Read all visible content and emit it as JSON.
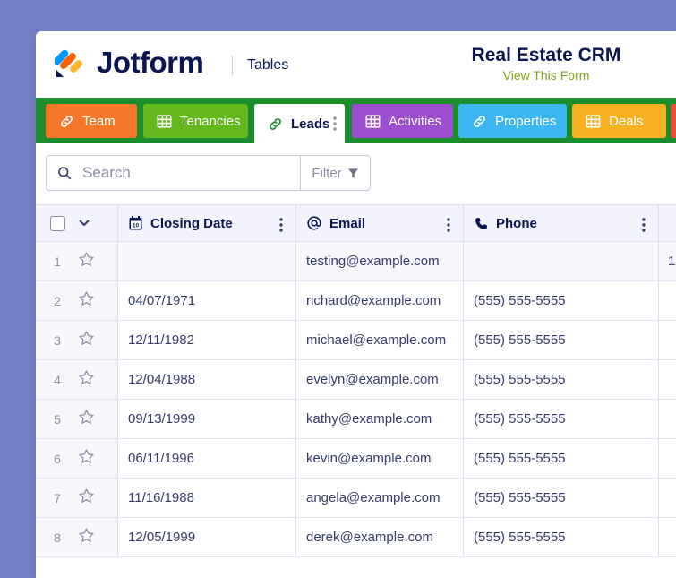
{
  "header": {
    "brand": "Jotform",
    "section": "Tables",
    "form_title": "Real Estate CRM",
    "form_link": "View This Form"
  },
  "tabs": [
    {
      "label": "Team",
      "icon": "link-icon",
      "color": "#f5782a",
      "active": false
    },
    {
      "label": "Tenancies",
      "icon": "grid-icon",
      "color": "#64b81c",
      "active": false
    },
    {
      "label": "Leads",
      "icon": "link-icon",
      "color": "#ffffff",
      "active": true
    },
    {
      "label": "Activities",
      "icon": "grid-icon",
      "color": "#9c4ed0",
      "active": false
    },
    {
      "label": "Properties",
      "icon": "link-icon",
      "color": "#3db7f4",
      "active": false
    },
    {
      "label": "Deals",
      "icon": "grid-icon",
      "color": "#f9b121",
      "active": false
    }
  ],
  "search": {
    "placeholder": "Search",
    "filter_label": "Filter"
  },
  "table": {
    "columns": [
      {
        "label": "Closing Date",
        "icon": "calendar-icon"
      },
      {
        "label": "Email",
        "icon": "at-icon"
      },
      {
        "label": "Phone",
        "icon": "phone-icon"
      }
    ],
    "rows": [
      {
        "num": "1",
        "date": "",
        "email": "testing@example.com",
        "phone": "",
        "extra": "1"
      },
      {
        "num": "2",
        "date": "04/07/1971",
        "email": "richard@example.com",
        "phone": "(555) 555-5555",
        "extra": ""
      },
      {
        "num": "3",
        "date": "12/11/1982",
        "email": "michael@example.com",
        "phone": "(555) 555-5555",
        "extra": ""
      },
      {
        "num": "4",
        "date": "12/04/1988",
        "email": "evelyn@example.com",
        "phone": "(555) 555-5555",
        "extra": ""
      },
      {
        "num": "5",
        "date": "09/13/1999",
        "email": "kathy@example.com",
        "phone": "(555) 555-5555",
        "extra": ""
      },
      {
        "num": "6",
        "date": "06/11/1996",
        "email": "kevin@example.com",
        "phone": "(555) 555-5555",
        "extra": ""
      },
      {
        "num": "7",
        "date": "11/16/1988",
        "email": "angela@example.com",
        "phone": "(555) 555-5555",
        "extra": ""
      },
      {
        "num": "8",
        "date": "12/05/1999",
        "email": "derek@example.com",
        "phone": "(555) 555-5555",
        "extra": ""
      }
    ]
  },
  "colors": {
    "background": "#7480c4",
    "tabbar": "#1b8d2c",
    "brand_text": "#0a1551",
    "form_link": "#7ba71b"
  }
}
